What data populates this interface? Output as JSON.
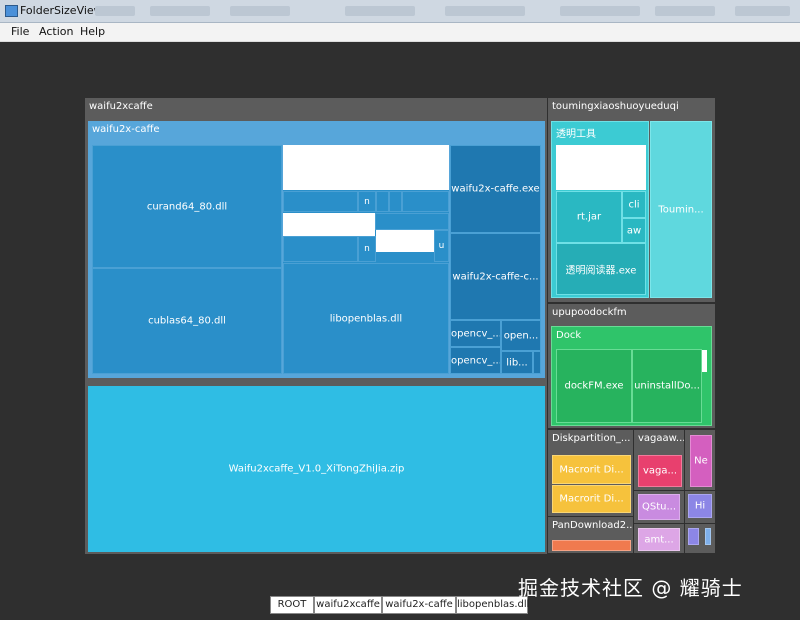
{
  "window": {
    "title": "FolderSizeView"
  },
  "menu": {
    "file": "File",
    "action": "Action",
    "help": "Help"
  },
  "tree": {
    "waifu2xcaffe": "waifu2xcaffe",
    "waifu2x_caffe": "waifu2x-caffe",
    "curand": "curand64_80.dll",
    "cublas": "cublas64_80.dll",
    "libopenblas": "libopenblas.dll",
    "n1": "n",
    "n2": "n",
    "u": "u",
    "exe": "waifu2x-caffe.exe",
    "exe_c": "waifu2x-caffe-c...",
    "opencv1": "opencv_...",
    "opencv2": "opencv_...",
    "open3": "open...",
    "lib": "lib...",
    "zip": "Waifu2xcaffe_V1.0_XiTongZhiJia.zip",
    "touming": "toumingxiaoshuoyueduqi",
    "tools": "透明工具",
    "rtjar": "rt.jar",
    "cli": "cli",
    "aw": "aw",
    "reader_exe": "透明阅读器.exe",
    "toumin": "Toumin...",
    "upupoo": "upupoodockfm",
    "dock": "Dock",
    "dockfm": "dockFM.exe",
    "uninstall": "uninstallDo...",
    "diskpartition": "Diskpartition_...",
    "macrorit1": "Macrorit Di...",
    "macrorit2": "Macrorit Di...",
    "vagaaw": "vagaaw...",
    "vaga": "vaga...",
    "ne": "Ne",
    "qstu": "QStu...",
    "hi": "Hi",
    "amt": "amt...",
    "pandownload": "PanDownload2..."
  },
  "breadcrumb": [
    "ROOT",
    "waifu2xcaffe",
    "waifu2x-caffe",
    "libopenblas.dll"
  ],
  "watermark": "掘金技术社区 @ 耀骑士",
  "colors": {
    "waifu_outer": "#5c5c5c",
    "waifu_caffe": "#57a6da",
    "dll_blue": "#2a8fc9",
    "dark_blue": "#1f78b0",
    "zip_cyan": "#2fbde4",
    "teal": "#3ccbd3",
    "green": "#2fc46a",
    "yellow": "#f6c23c",
    "pink": "#e8406e",
    "lilac": "#c98be0",
    "lavender": "#8c86e6",
    "orange": "#f07a4f"
  }
}
